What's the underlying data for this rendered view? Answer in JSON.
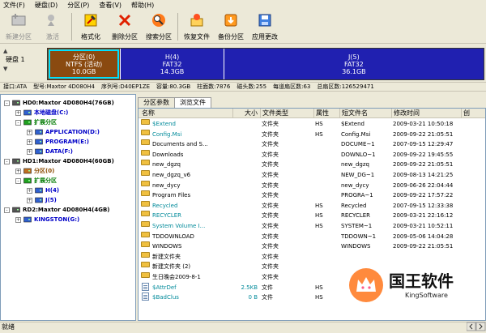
{
  "menu": [
    "文件(F)",
    "硬盘(D)",
    "分区(P)",
    "查看(V)",
    "帮助(H)"
  ],
  "toolbar": [
    {
      "label": "新建分区",
      "icon": "new-partition-icon",
      "disabled": true
    },
    {
      "label": "激活",
      "icon": "activate-icon",
      "disabled": true
    },
    {
      "label": "格式化",
      "icon": "format-icon",
      "disabled": false
    },
    {
      "label": "删除分区",
      "icon": "delete-partition-icon",
      "disabled": false
    },
    {
      "label": "搜索分区",
      "icon": "search-partition-icon",
      "disabled": false
    },
    {
      "label": "恢复文件",
      "icon": "recover-files-icon",
      "disabled": false
    },
    {
      "label": "备份分区",
      "icon": "backup-partition-icon",
      "disabled": false
    },
    {
      "label": "应用更改",
      "icon": "apply-changes-icon",
      "disabled": false
    }
  ],
  "disk_selector": {
    "label": "硬盘 1"
  },
  "partitions": [
    {
      "line1": "分区(0)",
      "line2": "NTFS (活动)",
      "line3": "10.0GB",
      "color": "#8a4a10",
      "share": 0.166,
      "selected": true
    },
    {
      "line1": "H(4)",
      "line2": "FAT32",
      "line3": "14.3GB",
      "color": "#2020b0",
      "share": 0.237,
      "selected": false
    },
    {
      "line1": "J(5)",
      "line2": "FAT32",
      "line3": "36.1GB",
      "color": "#2020b0",
      "share": 0.597,
      "selected": false
    }
  ],
  "disk_info": [
    "接口:ATA",
    "型号:Maxtor 4D080H4",
    "序列号:D40EP1ZE",
    "容量:80.3GB",
    "柱面数:7876",
    "磁头数:255",
    "每道扇区数:63",
    "总扇区数:126529471"
  ],
  "tree": [
    {
      "text": "HD0:Maxtor 4D080H4(76GB)",
      "level": 0,
      "color": "black",
      "exp": "-"
    },
    {
      "text": "本地磁盘(C:)",
      "level": 1,
      "color": "blue",
      "exp": "+"
    },
    {
      "text": "扩展分区",
      "level": 1,
      "color": "green",
      "exp": "-"
    },
    {
      "text": "APPLICATION(D:)",
      "level": 2,
      "color": "blue",
      "exp": "+"
    },
    {
      "text": "PROGRAM(E:)",
      "level": 2,
      "color": "blue",
      "exp": "+"
    },
    {
      "text": "DATA(F:)",
      "level": 2,
      "color": "blue",
      "exp": "+"
    },
    {
      "text": "HD1:Maxtor 4D080H4(60GB)",
      "level": 0,
      "color": "black",
      "exp": "-"
    },
    {
      "text": "分区(0)",
      "level": 1,
      "color": "brown",
      "exp": "+"
    },
    {
      "text": "扩展分区",
      "level": 1,
      "color": "green",
      "exp": "-"
    },
    {
      "text": "H(4)",
      "level": 2,
      "color": "blue",
      "exp": "+"
    },
    {
      "text": "J(5)",
      "level": 2,
      "color": "blue",
      "exp": "+"
    },
    {
      "text": "RD2:Maxtor 4D080H4(4GB)",
      "level": 0,
      "color": "black",
      "exp": "-"
    },
    {
      "text": "KINGSTON(G:)",
      "level": 1,
      "color": "blue",
      "exp": "+"
    }
  ],
  "tabs": [
    "分区参数",
    "浏览文件"
  ],
  "columns": [
    "名称",
    "大小",
    "文件类型",
    "属性",
    "短文件名",
    "修改时间",
    "创"
  ],
  "files": [
    {
      "name": "$Extend",
      "size": "",
      "type": "文件夹",
      "attr": "HS",
      "short": "$Extend",
      "date": "2009-03-21 10:50:18",
      "kind": "folder",
      "cyan": true
    },
    {
      "name": "Config.Msi",
      "size": "",
      "type": "文件夹",
      "attr": "HS",
      "short": "Config.Msi",
      "date": "2009-09-22 21:05:51",
      "kind": "folder",
      "cyan": true
    },
    {
      "name": "Documents and S...",
      "size": "",
      "type": "文件夹",
      "attr": "",
      "short": "DOCUME~1",
      "date": "2007-09-15 12:29:47",
      "kind": "folder",
      "cyan": false
    },
    {
      "name": "Downloads",
      "size": "",
      "type": "文件夹",
      "attr": "",
      "short": "DOWNLO~1",
      "date": "2009-09-22 19:45:55",
      "kind": "folder",
      "cyan": false
    },
    {
      "name": "new_dgzq",
      "size": "",
      "type": "文件夹",
      "attr": "",
      "short": "new_dgzq",
      "date": "2009-09-22 21:05:51",
      "kind": "folder",
      "cyan": false
    },
    {
      "name": "new_dgzq_v6",
      "size": "",
      "type": "文件夹",
      "attr": "",
      "short": "NEW_DG~1",
      "date": "2009-08-13 14:21:25",
      "kind": "folder",
      "cyan": false
    },
    {
      "name": "new_dycy",
      "size": "",
      "type": "文件夹",
      "attr": "",
      "short": "new_dycy",
      "date": "2009-06-26 22:04:44",
      "kind": "folder",
      "cyan": false
    },
    {
      "name": "Program Files",
      "size": "",
      "type": "文件夹",
      "attr": "",
      "short": "PROGRA~1",
      "date": "2009-09-22 17:57:22",
      "kind": "folder",
      "cyan": false
    },
    {
      "name": "Recycled",
      "size": "",
      "type": "文件夹",
      "attr": "HS",
      "short": "Recycled",
      "date": "2007-09-15 12:33:38",
      "kind": "folder",
      "cyan": true
    },
    {
      "name": "RECYCLER",
      "size": "",
      "type": "文件夹",
      "attr": "HS",
      "short": "RECYCLER",
      "date": "2009-03-21 22:16:12",
      "kind": "folder",
      "cyan": true
    },
    {
      "name": "System Volume I...",
      "size": "",
      "type": "文件夹",
      "attr": "HS",
      "short": "SYSTEM~1",
      "date": "2009-03-21 10:52:11",
      "kind": "folder",
      "cyan": true
    },
    {
      "name": "TDDOWNLOAD",
      "size": "",
      "type": "文件夹",
      "attr": "",
      "short": "TDDOWN~1",
      "date": "2009-05-06 14:04:28",
      "kind": "folder",
      "cyan": false
    },
    {
      "name": "WINDOWS",
      "size": "",
      "type": "文件夹",
      "attr": "",
      "short": "WINDOWS",
      "date": "2009-09-22 21:05:51",
      "kind": "folder",
      "cyan": false
    },
    {
      "name": "新建文件夹",
      "size": "",
      "type": "文件夹",
      "attr": "",
      "short": "",
      "date": "",
      "kind": "folder",
      "cyan": false
    },
    {
      "name": "新建文件夹 (2)",
      "size": "",
      "type": "文件夹",
      "attr": "",
      "short": "",
      "date": "",
      "kind": "folder",
      "cyan": false
    },
    {
      "name": "生日晚会2009-8-1",
      "size": "",
      "type": "文件夹",
      "attr": "",
      "short": "",
      "date": "",
      "kind": "folder",
      "cyan": false
    },
    {
      "name": "$AttrDef",
      "size": "2.5KB",
      "type": "文件",
      "attr": "HS",
      "short": "",
      "date": "",
      "kind": "file",
      "cyan": true
    },
    {
      "name": "$BadClus",
      "size": "0 B",
      "type": "文件",
      "attr": "HS",
      "short": "",
      "date": "",
      "kind": "file",
      "cyan": true
    }
  ],
  "status": "就绪",
  "watermark": {
    "title": "国王软件",
    "sub": "KingSoftware"
  },
  "colors": {
    "ntfs_partition": "#8a4a10",
    "fat32_partition": "#2020b0",
    "selected_outline": "#00e0ff"
  }
}
